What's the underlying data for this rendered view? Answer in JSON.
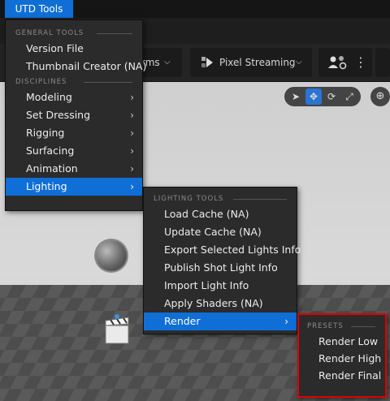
{
  "menubar": {
    "title": "UTD Tools"
  },
  "toolbar": {
    "modes_label": "rms",
    "pixel_streaming_label": "Pixel Streaming"
  },
  "main_menu": {
    "general_header": "GENERAL TOOLS",
    "general_items": [
      {
        "label": "Version File"
      },
      {
        "label": "Thumbnail Creator (NA)"
      }
    ],
    "disciplines_header": "DISCIPLINES",
    "discipline_items": [
      {
        "label": "Modeling"
      },
      {
        "label": "Set Dressing"
      },
      {
        "label": "Rigging"
      },
      {
        "label": "Surfacing"
      },
      {
        "label": "Animation"
      },
      {
        "label": "Lighting",
        "selected": true
      }
    ]
  },
  "lighting_menu": {
    "header": "LIGHTING TOOLS",
    "items": [
      {
        "label": "Load Cache (NA)"
      },
      {
        "label": "Update Cache (NA)"
      },
      {
        "label": "Export Selected Lights Info"
      },
      {
        "label": "Publish Shot Light Info"
      },
      {
        "label": "Import Light Info"
      },
      {
        "label": "Apply Shaders (NA)"
      },
      {
        "label": "Render",
        "selected": true
      }
    ]
  },
  "render_menu": {
    "header": "PRESETS",
    "items": [
      {
        "label": "Render Low"
      },
      {
        "label": "Render High"
      },
      {
        "label": "Render Final"
      }
    ],
    "highlight_color": "#e00000"
  },
  "colors": {
    "accent": "#0f6fd6",
    "menu_bg": "#2b2b2b"
  }
}
